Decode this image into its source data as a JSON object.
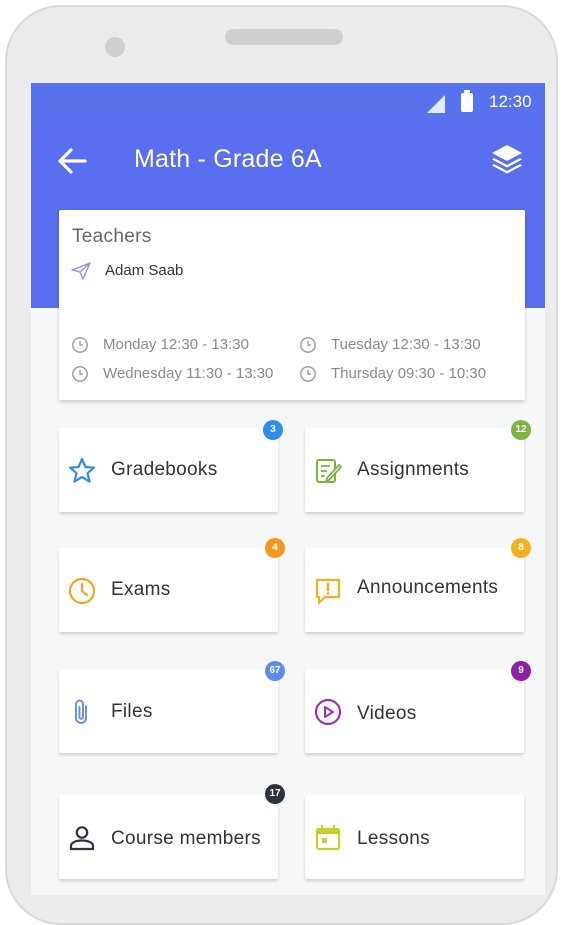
{
  "status_bar": {
    "time": "12:30"
  },
  "header": {
    "title": "Math - Grade 6A"
  },
  "teacher_card": {
    "label": "Teachers",
    "teacher_name": "Adam Saab",
    "schedule": [
      "Monday 12:30 - 13:30",
      "Tuesday 12:30 - 13:30",
      "Wednesday 11:30 - 13:30",
      "Thursday 09:30 - 10:30"
    ]
  },
  "tiles": [
    {
      "label": "Gradebooks",
      "badge": "3",
      "badge_color": "#2f8fe8",
      "icon": "star-icon",
      "icon_color": "#2f8fe8"
    },
    {
      "label": "Assignments",
      "badge": "12",
      "badge_color": "#7cb342",
      "icon": "edit-note-icon",
      "icon_color": "#7cb342"
    },
    {
      "label": "Exams",
      "badge": "4",
      "badge_color": "#f39a1e",
      "icon": "clock-icon",
      "icon_color": "#f3a41e"
    },
    {
      "label": "Announcements",
      "badge": "8",
      "badge_color": "#f5b022",
      "icon": "announcement-icon",
      "icon_color": "#f5b022"
    },
    {
      "label": "Files",
      "badge": "67",
      "badge_color": "#5e8df0",
      "icon": "paperclip-icon",
      "icon_color": "#6f8fe6"
    },
    {
      "label": "Videos",
      "badge": "9",
      "badge_color": "#8e1fa6",
      "icon": "play-circle-icon",
      "icon_color": "#9a33b5"
    },
    {
      "label": "Course members",
      "badge": "17",
      "badge_color": "#2b3340",
      "icon": "person-icon",
      "icon_color": "#2b3340"
    },
    {
      "label": "Lessons",
      "badge": "",
      "badge_color": "",
      "icon": "calendar-icon",
      "icon_color": "#c5d12a"
    }
  ],
  "colors": {
    "header": "#5a6ff0",
    "status_bar": "#5872ee"
  }
}
